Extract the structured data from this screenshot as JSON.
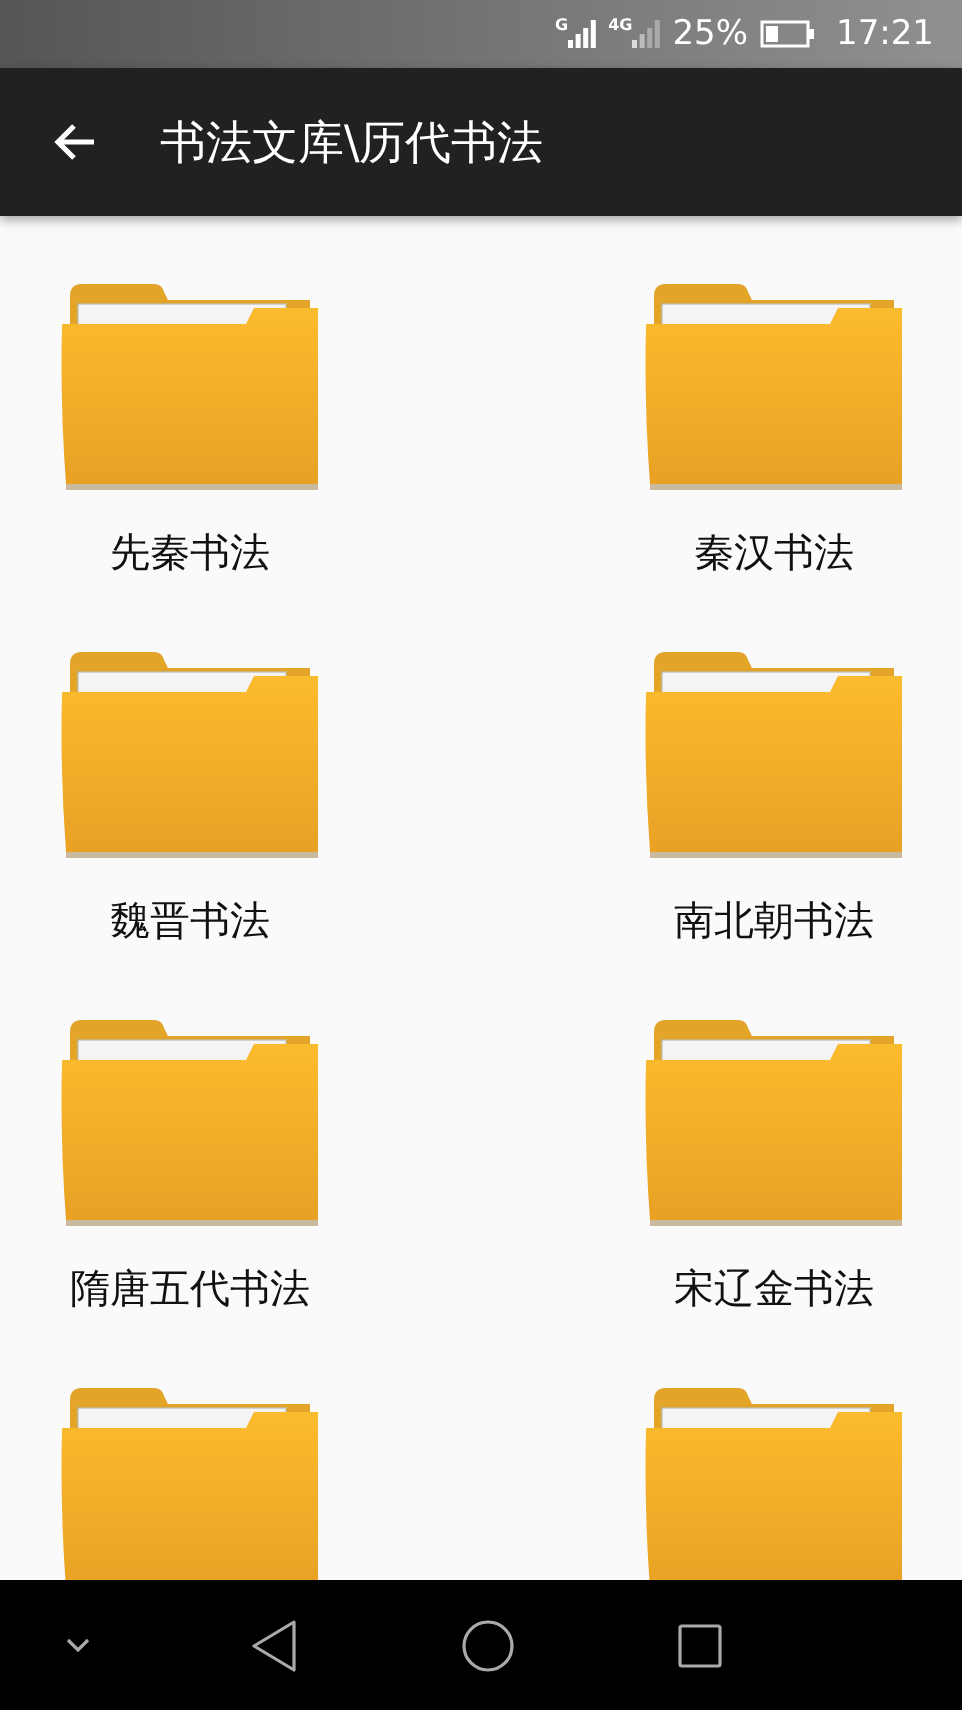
{
  "status_bar": {
    "signal_1": "G",
    "signal_2": "4G",
    "battery": "25%",
    "time": "17:21"
  },
  "app_bar": {
    "title": "书法文库\\历代书法"
  },
  "folders": [
    {
      "kind": "folder",
      "label": "先秦书法"
    },
    {
      "kind": "folder",
      "label": "秦汉书法"
    },
    {
      "kind": "folder",
      "label": "魏晋书法"
    },
    {
      "kind": "folder",
      "label": "南北朝书法"
    },
    {
      "kind": "folder",
      "label": "隋唐五代书法"
    },
    {
      "kind": "folder",
      "label": "宋辽金书法"
    },
    {
      "kind": "folder"
    },
    {
      "kind": "folder"
    }
  ]
}
